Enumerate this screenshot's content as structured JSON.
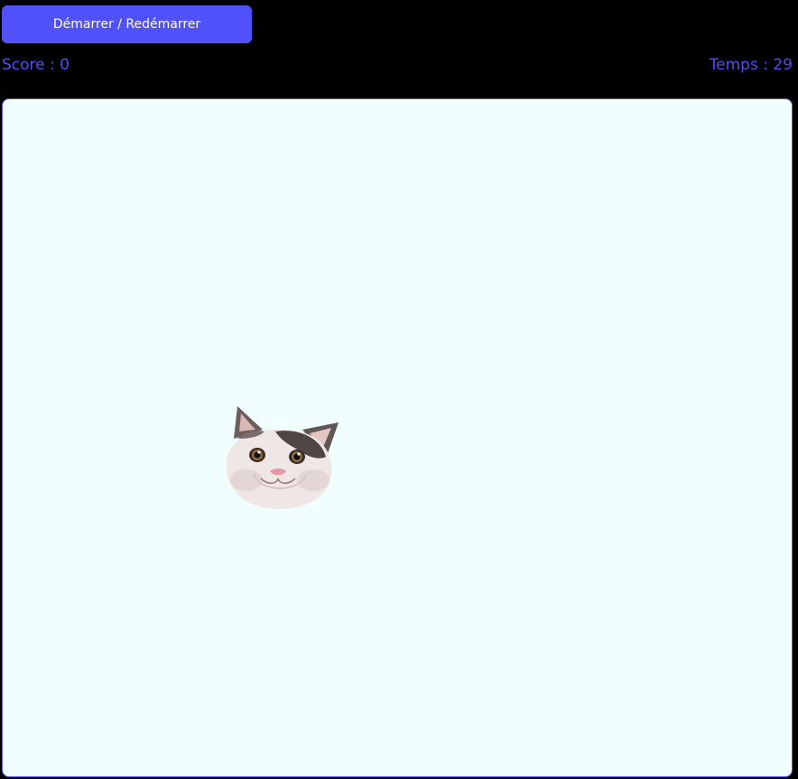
{
  "controls": {
    "start_label": "Démarrer / Redémarrer"
  },
  "hud": {
    "score_text": "Score : 0",
    "time_text": "Temps : 29"
  },
  "board": {
    "target": "cat-head"
  },
  "colors": {
    "accent": "#5151fa",
    "hud_text": "#4f4ff0",
    "board_bg": "#f0fffe",
    "page_bg": "#000000"
  }
}
